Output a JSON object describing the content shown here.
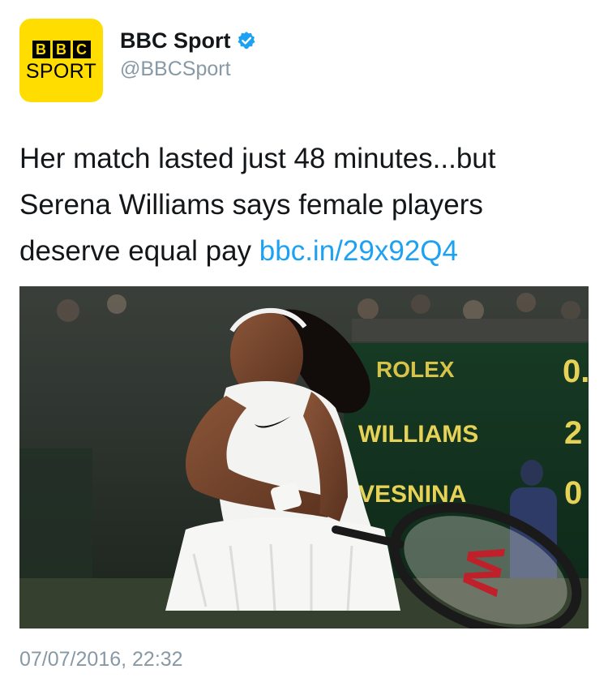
{
  "author": {
    "display_name": "BBC Sport",
    "handle": "@BBCSport",
    "verified": true,
    "avatar": {
      "letters": [
        "B",
        "B",
        "C"
      ],
      "word": "SPORT",
      "bg_color": "#ffdd00"
    }
  },
  "tweet": {
    "text": "Her match lasted just 48 minutes...but Serena Williams says female players deserve equal pay ",
    "link": "bbc.in/29x92Q4"
  },
  "media": {
    "scoreboard": {
      "brand": "ROLEX",
      "rows": [
        {
          "name": "WILLIAMS",
          "score": "2"
        },
        {
          "name": "VESNINA",
          "score": "0"
        }
      ],
      "top_score": "0."
    },
    "racket_logo": "W"
  },
  "timestamp": "07/07/2016, 22:32",
  "colors": {
    "link": "#1da1f2",
    "secondary_text": "#8899a6",
    "primary_text": "#14171a",
    "verified": "#1da1f2"
  },
  "icons": {
    "verified": "verified-badge-icon",
    "swoosh": "nike-swoosh-icon"
  }
}
